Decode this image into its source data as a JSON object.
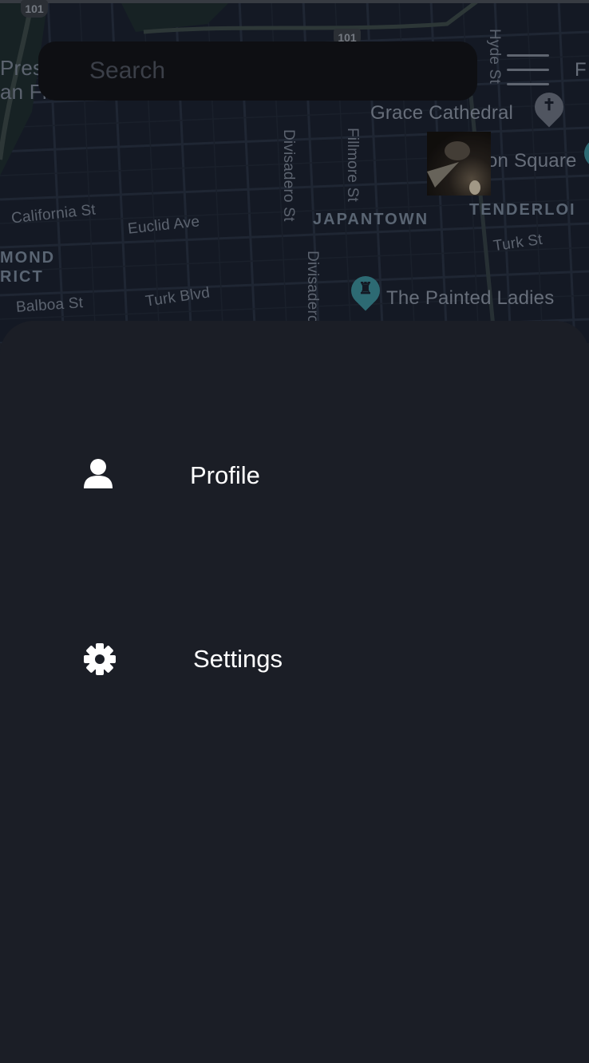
{
  "map": {
    "labels": {
      "california_st": "California St",
      "euclid_ave": "Euclid Ave",
      "balboa_st": "Balboa St",
      "turk_blvd": "Turk Blvd",
      "turk_st": "Turk St",
      "divisadero_st_1": "Divisadero St",
      "divisadero_st_2": "Divisadero",
      "fillmore_st": "Fillmore St",
      "hyde_st": "Hyde St",
      "japantown": "JAPANTOWN",
      "tenderloin": "TENDERLOI",
      "richmond_line1": "MOND",
      "richmond_line2": "RICT",
      "presidio_line1": "Pres",
      "presidio_line2": "an Fra",
      "grace_cathedral": "Grace Cathedral",
      "union_square": "on Square",
      "painted_ladies": "The Painted Ladies",
      "edge_f": "F"
    },
    "highway_shields": [
      "101",
      "101"
    ],
    "colors": {
      "background": "#1b2230",
      "pin_gray": "#6b7280",
      "pin_teal": "#3d8e9a"
    }
  },
  "search": {
    "placeholder": "Search"
  },
  "menu": {
    "icon": "hamburger-menu-icon"
  },
  "drawer": {
    "items": [
      {
        "label": "Profile",
        "icon": "person-icon"
      },
      {
        "label": "Settings",
        "icon": "gear-icon"
      }
    ]
  }
}
